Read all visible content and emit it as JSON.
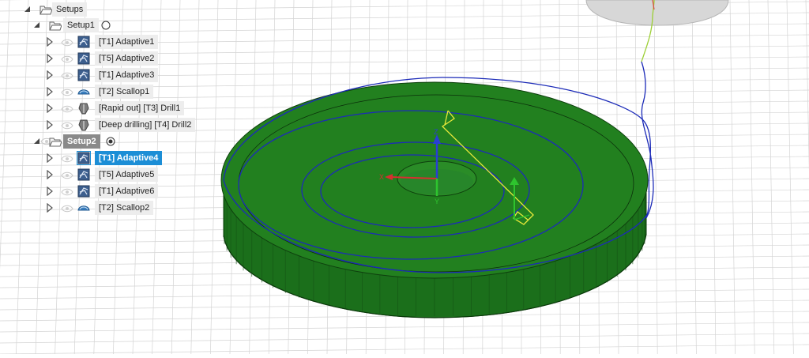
{
  "browser": {
    "root": {
      "label": "Setups",
      "icon": "folder-icon"
    },
    "setups": [
      {
        "label": "Setup1",
        "active": false,
        "operations": [
          {
            "label": "[T1] Adaptive1",
            "icon": "adaptive-toolpath-icon"
          },
          {
            "label": "[T5] Adaptive2",
            "icon": "adaptive-toolpath-icon"
          },
          {
            "label": "[T1] Adaptive3",
            "icon": "adaptive-toolpath-icon"
          },
          {
            "label": "[T2] Scallop1",
            "icon": "scallop-toolpath-icon"
          },
          {
            "label": "[Rapid out] [T3] Drill1",
            "icon": "drill-toolpath-icon"
          },
          {
            "label": "[Deep drilling] [T4] Drill2",
            "icon": "drill-toolpath-icon"
          }
        ]
      },
      {
        "label": "Setup2",
        "active": true,
        "operations": [
          {
            "label": "[T1] Adaptive4",
            "icon": "adaptive-toolpath-icon",
            "selected": true
          },
          {
            "label": "[T5] Adaptive5",
            "icon": "adaptive-toolpath-icon"
          },
          {
            "label": "[T1] Adaptive6",
            "icon": "adaptive-toolpath-icon"
          },
          {
            "label": "[T2] Scallop2",
            "icon": "scallop-toolpath-icon"
          }
        ]
      }
    ]
  },
  "viewport": {
    "axis_labels": {
      "z": "Z",
      "x": "X",
      "y": "Y"
    },
    "colors": {
      "part": "#1f7f1f",
      "part_side": "#1a6e1a",
      "toolpath": "#1c2bb8",
      "rapid": "#e6e633",
      "selection": "#1c8ed6",
      "grid": "#d4d4d4"
    }
  }
}
